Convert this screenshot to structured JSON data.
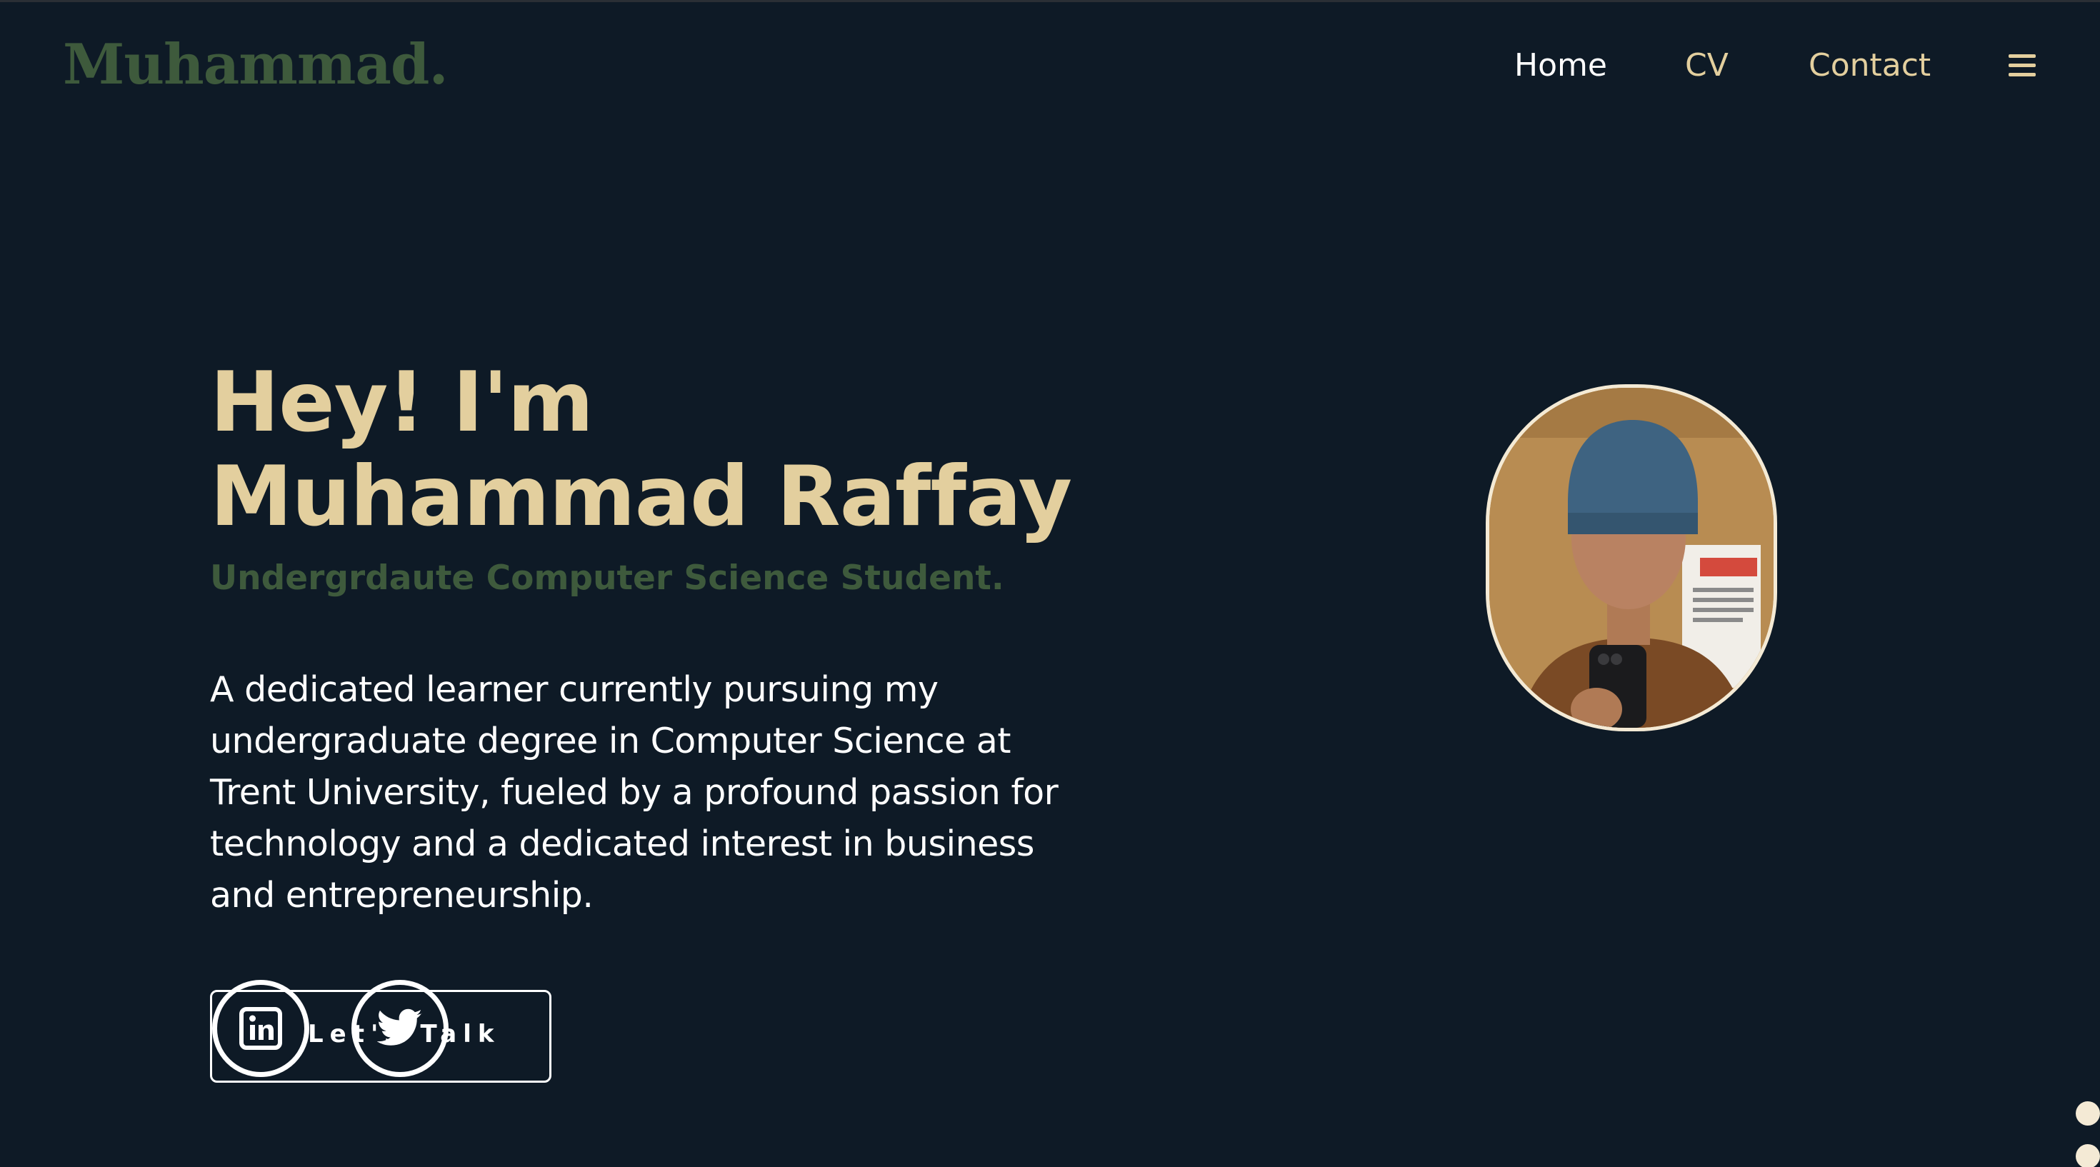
{
  "header": {
    "logo": "Muhammad.",
    "nav": {
      "home": "Home",
      "cv": "CV",
      "contact": "Contact"
    },
    "menu_icon": "hamburger-menu-icon"
  },
  "hero": {
    "title": "Hey! I'm Muhammad Raffay",
    "subtitle": "Undergrdaute Computer Science Student.",
    "description": "A dedicated learner currently pursuing my undergraduate degree in Computer Science at Trent University, fueled by a profound passion for technology and a dedicated interest in business and entrepreneurship.",
    "cta_label": "Let's Talk",
    "social": [
      {
        "name": "linkedin",
        "icon": "linkedin-icon"
      },
      {
        "name": "twitter",
        "icon": "twitter-icon"
      }
    ]
  },
  "profile_image": {
    "subject": "portrait"
  },
  "colors": {
    "background": "#0e1a26",
    "accent_gold": "#e3cf9e",
    "accent_green": "#3e5a3c",
    "text_white": "#ffffff"
  }
}
